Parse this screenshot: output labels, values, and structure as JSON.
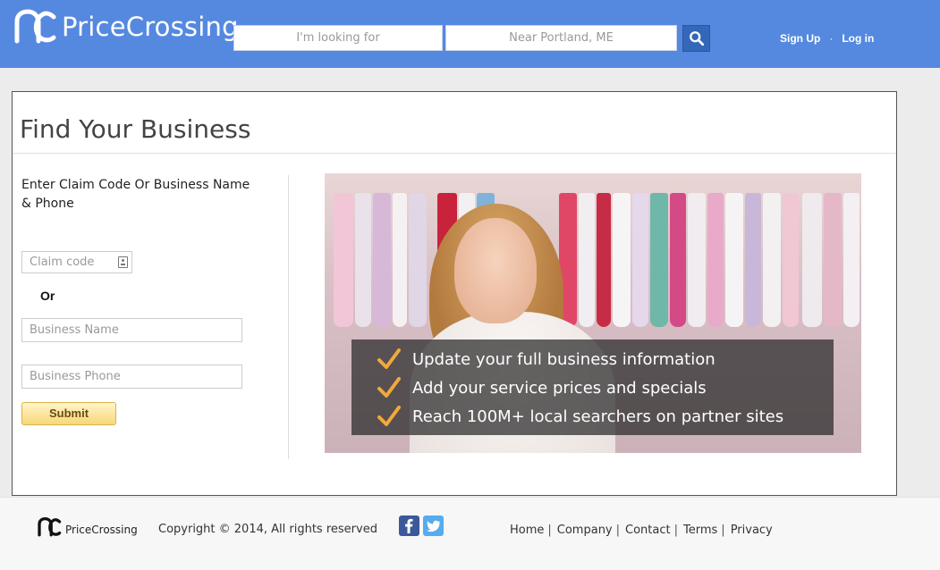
{
  "header": {
    "logo_text": "PriceCrossing",
    "search_what_placeholder": "I'm looking for",
    "search_where_placeholder": "Near Portland, ME",
    "search_icon": "magnifier-icon",
    "signup_label": "Sign Up",
    "separator": "·",
    "login_label": "Log in"
  },
  "main": {
    "title": "Find Your Business",
    "instructions": "Enter Claim Code Or Business Name & Phone",
    "claim_placeholder": "Claim code",
    "or_label": "Or",
    "business_name_placeholder": "Business Name",
    "business_phone_placeholder": "Business Phone",
    "submit_label": "Submit",
    "benefits": [
      "Update your full business information",
      "Add your service prices and specials",
      "Reach 100M+ local searchers on partner sites"
    ]
  },
  "footer": {
    "logo_text": "PriceCrossing",
    "copyright": "Copyright © 2014, All rights reserved",
    "social_icons": [
      "facebook-icon",
      "twitter-icon"
    ],
    "links": [
      "Home",
      "Company",
      "Contact",
      "Terms",
      "Privacy"
    ],
    "link_separator": "|"
  },
  "colors": {
    "header_bg": "#5589e0",
    "search_button": "#3567b8",
    "submit_gradient_top": "#fff5c9",
    "submit_gradient_bottom": "#f7d878",
    "check_color": "#f2a93b"
  }
}
